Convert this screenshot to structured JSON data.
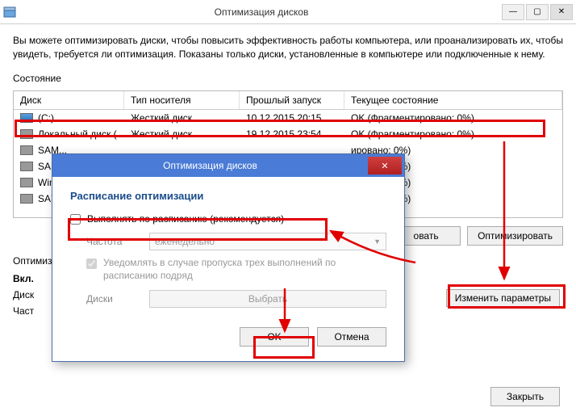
{
  "titlebar": {
    "title": "Оптимизация дисков"
  },
  "intro": "Вы можете оптимизировать диски, чтобы повысить эффективность работы компьютера, или проанализировать их, чтобы увидеть, требуется ли оптимизация. Показаны только диски, установленные в компьютере или подключенные к нему.",
  "section_label": "Состояние",
  "columns": {
    "disk": "Диск",
    "type": "Тип носителя",
    "last": "Прошлый запуск",
    "status": "Текущее состояние"
  },
  "rows": [
    {
      "disk": "(C:)",
      "type": "Жесткий диск",
      "last": "10.12.2015 20:15",
      "status": "OK (Фрагментировано: 0%)",
      "primary": true
    },
    {
      "disk": "Локальный диск (...",
      "type": "Жесткий диск",
      "last": "19.12.2015 23:54",
      "status": "OK (Фрагментировано: 0%)"
    },
    {
      "disk": "SAM...",
      "type": "",
      "last": "",
      "status": "ировано: 0%)"
    },
    {
      "disk": "SAM...",
      "type": "",
      "last": "",
      "status": "ировано: 0%)"
    },
    {
      "disk": "Wind...",
      "type": "",
      "last": "",
      "status": "ировано: 0%)"
    },
    {
      "disk": "SA7...",
      "type": "",
      "last": "",
      "status": "ировано: 0%)"
    }
  ],
  "buttons": {
    "analyze": "овать",
    "optimize": "Оптимизировать",
    "change": "Изменить параметры",
    "close": "Закрыть"
  },
  "schedule": {
    "label": "Оптимизация по расписанию",
    "enabled": "Вкл.",
    "details1": "Диск",
    "details2": "Част"
  },
  "dialog": {
    "title": "Оптимизация дисков",
    "heading": "Расписание оптимизации",
    "run_scheduled": "Выполнять по расписанию (рекомендуется)",
    "frequency_label": "Частота",
    "frequency_value": "еженедельно",
    "notify": "Уведомлять в случае пропуска трех выполнений по расписанию подряд",
    "disks_label": "Диски",
    "select_button": "Выбрать",
    "ok": "OK",
    "cancel": "Отмена"
  }
}
